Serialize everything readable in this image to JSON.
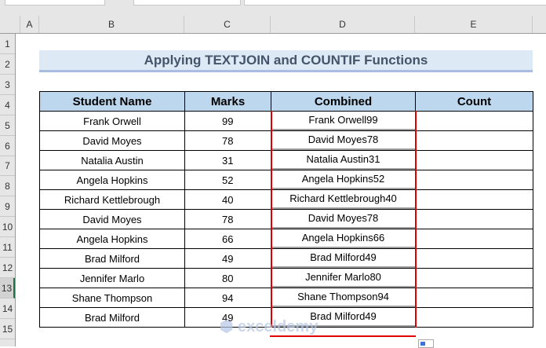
{
  "columns": [
    "A",
    "B",
    "C",
    "D",
    "E"
  ],
  "rows": [
    "1",
    "2",
    "3",
    "4",
    "5",
    "6",
    "7",
    "8",
    "9",
    "10",
    "11",
    "12",
    "13",
    "14",
    "15"
  ],
  "title": "Applying TEXTJOIN and COUNTIF Functions",
  "headers": [
    "Student Name",
    "Marks",
    "Combined",
    "Count"
  ],
  "data": [
    [
      "Frank Orwell",
      "99",
      "Frank Orwell99",
      ""
    ],
    [
      "David Moyes",
      "78",
      "David Moyes78",
      ""
    ],
    [
      "Natalia Austin",
      "31",
      "Natalia Austin31",
      ""
    ],
    [
      "Angela Hopkins",
      "52",
      "Angela Hopkins52",
      ""
    ],
    [
      "Richard Kettlebrough",
      "40",
      "Richard Kettlebrough40",
      ""
    ],
    [
      "David Moyes",
      "78",
      "David Moyes78",
      ""
    ],
    [
      "Angela Hopkins",
      "66",
      "Angela Hopkins66",
      ""
    ],
    [
      "Brad Milford",
      "49",
      "Brad Milford49",
      ""
    ],
    [
      "Jennifer Marlo",
      "80",
      "Jennifer Marlo80",
      ""
    ],
    [
      "Shane Thompson",
      "94",
      "Shane Thompson94",
      ""
    ],
    [
      "Brad Milford",
      "49",
      "Brad Milford49",
      ""
    ]
  ],
  "watermark": "exceldemy"
}
